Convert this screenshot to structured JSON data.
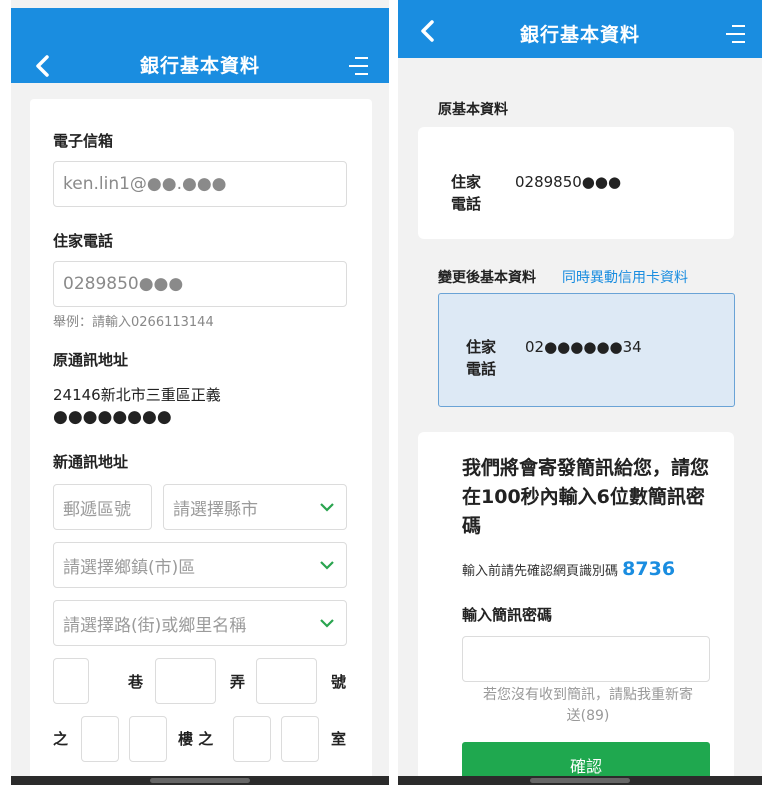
{
  "left": {
    "title": "銀行基本資料",
    "email_label": "電子信箱",
    "email_value": "ken.lin1@●●.●●●",
    "phone_label": "住家電話",
    "phone_value": "0289850●●●",
    "phone_hint": "舉例：請輸入0266113144",
    "old_address_label": "原通訊地址",
    "old_address_line1": "24146新北市三重區正義",
    "old_address_line2": "●●●●●●●●",
    "new_address_label": "新通訊地址",
    "zip_placeholder": "郵遞區號",
    "county_placeholder": "請選擇縣市",
    "town_placeholder": "請選擇鄉鎮(市)區",
    "road_placeholder": "請選擇路(街)或鄉里名稱",
    "unit_lane": "巷",
    "unit_alley": "弄",
    "unit_number": "號",
    "unit_of": "之",
    "unit_floor_of": "樓 之",
    "unit_room": "室"
  },
  "right": {
    "title": "銀行基本資料",
    "original_section": "原基本資料",
    "original_key": "住家電話",
    "original_value": "0289850●●●",
    "changed_section": "變更後基本資料",
    "sync_link": "同時異動信用卡資料",
    "changed_key": "住家電話",
    "changed_value": "02●●●●●●34",
    "sms_notice": "我們將會寄發簡訊給您，請您在100秒內輸入6位數簡訊密碼",
    "verify_prefix": "輸入前請先確認網頁識別碼",
    "verify_code": "8736",
    "sms_input_label": "輸入簡訊密碼",
    "resend_text": "若您沒有收到簡訊，請點我重新寄送(89)",
    "confirm_button": "確認"
  },
  "colors": {
    "appbar": "#1a8de0",
    "accent_link": "#1a8de0",
    "confirm": "#1fa84f",
    "highlight_card": "#dde9f5"
  },
  "icons": [
    "back-icon",
    "menu-icon",
    "chevron-down-icon"
  ]
}
